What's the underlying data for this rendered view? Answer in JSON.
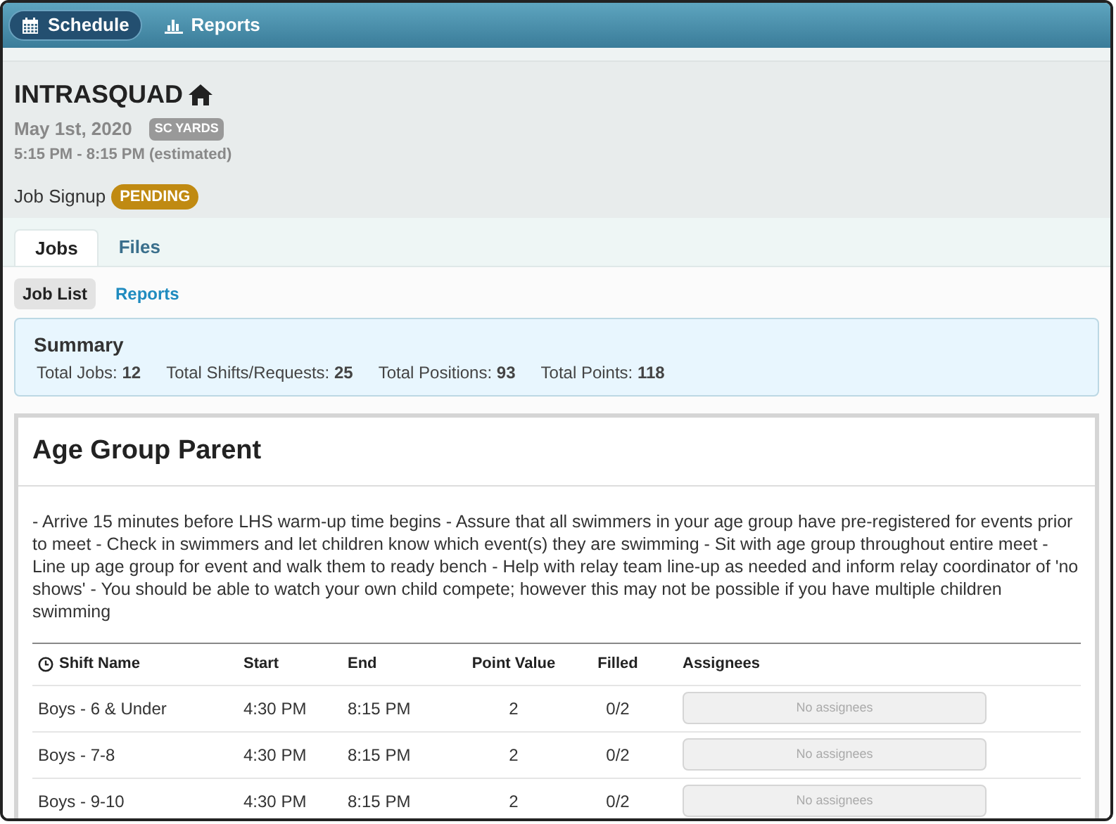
{
  "nav": [
    {
      "label": "Schedule",
      "kind": "calendar",
      "selected": true
    },
    {
      "label": "Reports",
      "kind": "chart",
      "selected": false
    }
  ],
  "meet": {
    "title": "INTRASQUAD",
    "date": "May 1st, 2020",
    "course": "SC YARDS",
    "time": "5:15 PM - 8:15 PM (estimated)",
    "signup_label": "Job Signup",
    "signup_status": "PENDING"
  },
  "tabs": [
    {
      "label": "Jobs",
      "selected": true
    },
    {
      "label": "Files",
      "selected": false
    }
  ],
  "subtabs": [
    {
      "label": "Job List",
      "selected": true
    },
    {
      "label": "Reports",
      "selected": false
    }
  ],
  "summary": {
    "title": "Summary",
    "stats": [
      {
        "label": "Total Jobs:",
        "value": "12"
      },
      {
        "label": "Total Shifts/Requests:",
        "value": "25"
      },
      {
        "label": "Total Positions:",
        "value": "93"
      },
      {
        "label": "Total Points:",
        "value": "118"
      }
    ]
  },
  "job": {
    "title": "Age Group Parent",
    "description": "- Arrive 15 minutes before LHS warm-up time begins - Assure that all swimmers in your age group have pre-registered for events prior to meet - Check in swimmers and let children know which event(s) they are swimming - Sit with age group throughout entire meet - Line up age group for event and walk them to ready bench - Help with relay team line-up as needed and inform relay coordinator of 'no shows' - You should be able to watch your own child compete; however this may not be possible if you have multiple children swimming",
    "columns": [
      "Shift Name",
      "Start",
      "End",
      "Point Value",
      "Filled",
      "Assignees"
    ],
    "rows": [
      {
        "shift": "Boys - 6 & Under",
        "start": "4:30 PM",
        "end": "8:15 PM",
        "points": "2",
        "filled": "0/2",
        "assignees": "No assignees"
      },
      {
        "shift": "Boys - 7-8",
        "start": "4:30 PM",
        "end": "8:15 PM",
        "points": "2",
        "filled": "0/2",
        "assignees": "No assignees"
      },
      {
        "shift": "Boys - 9-10",
        "start": "4:30 PM",
        "end": "8:15 PM",
        "points": "2",
        "filled": "0/2",
        "assignees": "No assignees"
      }
    ]
  }
}
